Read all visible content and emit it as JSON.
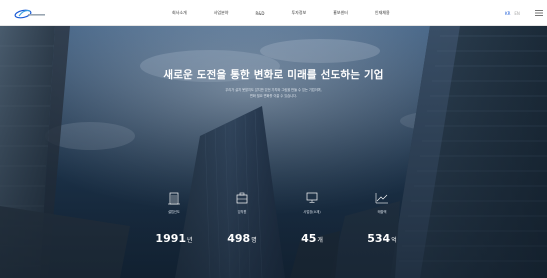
{
  "header": {
    "nav": [
      "회사소개",
      "사업분야",
      "R&D",
      "투자정보",
      "홍보센터",
      "인재채용"
    ],
    "lang": {
      "active": "KR",
      "inactive": "EN"
    }
  },
  "hero": {
    "headline": "새로운 도전을 통한 변화로 미래를 선도하는 기업",
    "subcopy_line1": "우리가 살지 못할지도 않지만 있던 가치와 그림을 만들 수 있는 기업이며,",
    "subcopy_line2": "변화 필요 변화를 이끌 수 있습니다."
  },
  "stats": [
    {
      "icon": "building-icon",
      "label": "설립년도",
      "value": "1991",
      "unit": "년"
    },
    {
      "icon": "briefcase-icon",
      "label": "임직원",
      "value": "498",
      "unit": "명"
    },
    {
      "icon": "monitor-icon",
      "label": "사업장(소재)",
      "value": "45",
      "unit": "개"
    },
    {
      "icon": "chart-up-icon",
      "label": "매출액",
      "value": "534",
      "unit": "억"
    }
  ],
  "colors": {
    "accent": "#1a5bd6",
    "hero_sky_top": "#3f5f82",
    "hero_sky_bottom": "#172b40"
  }
}
